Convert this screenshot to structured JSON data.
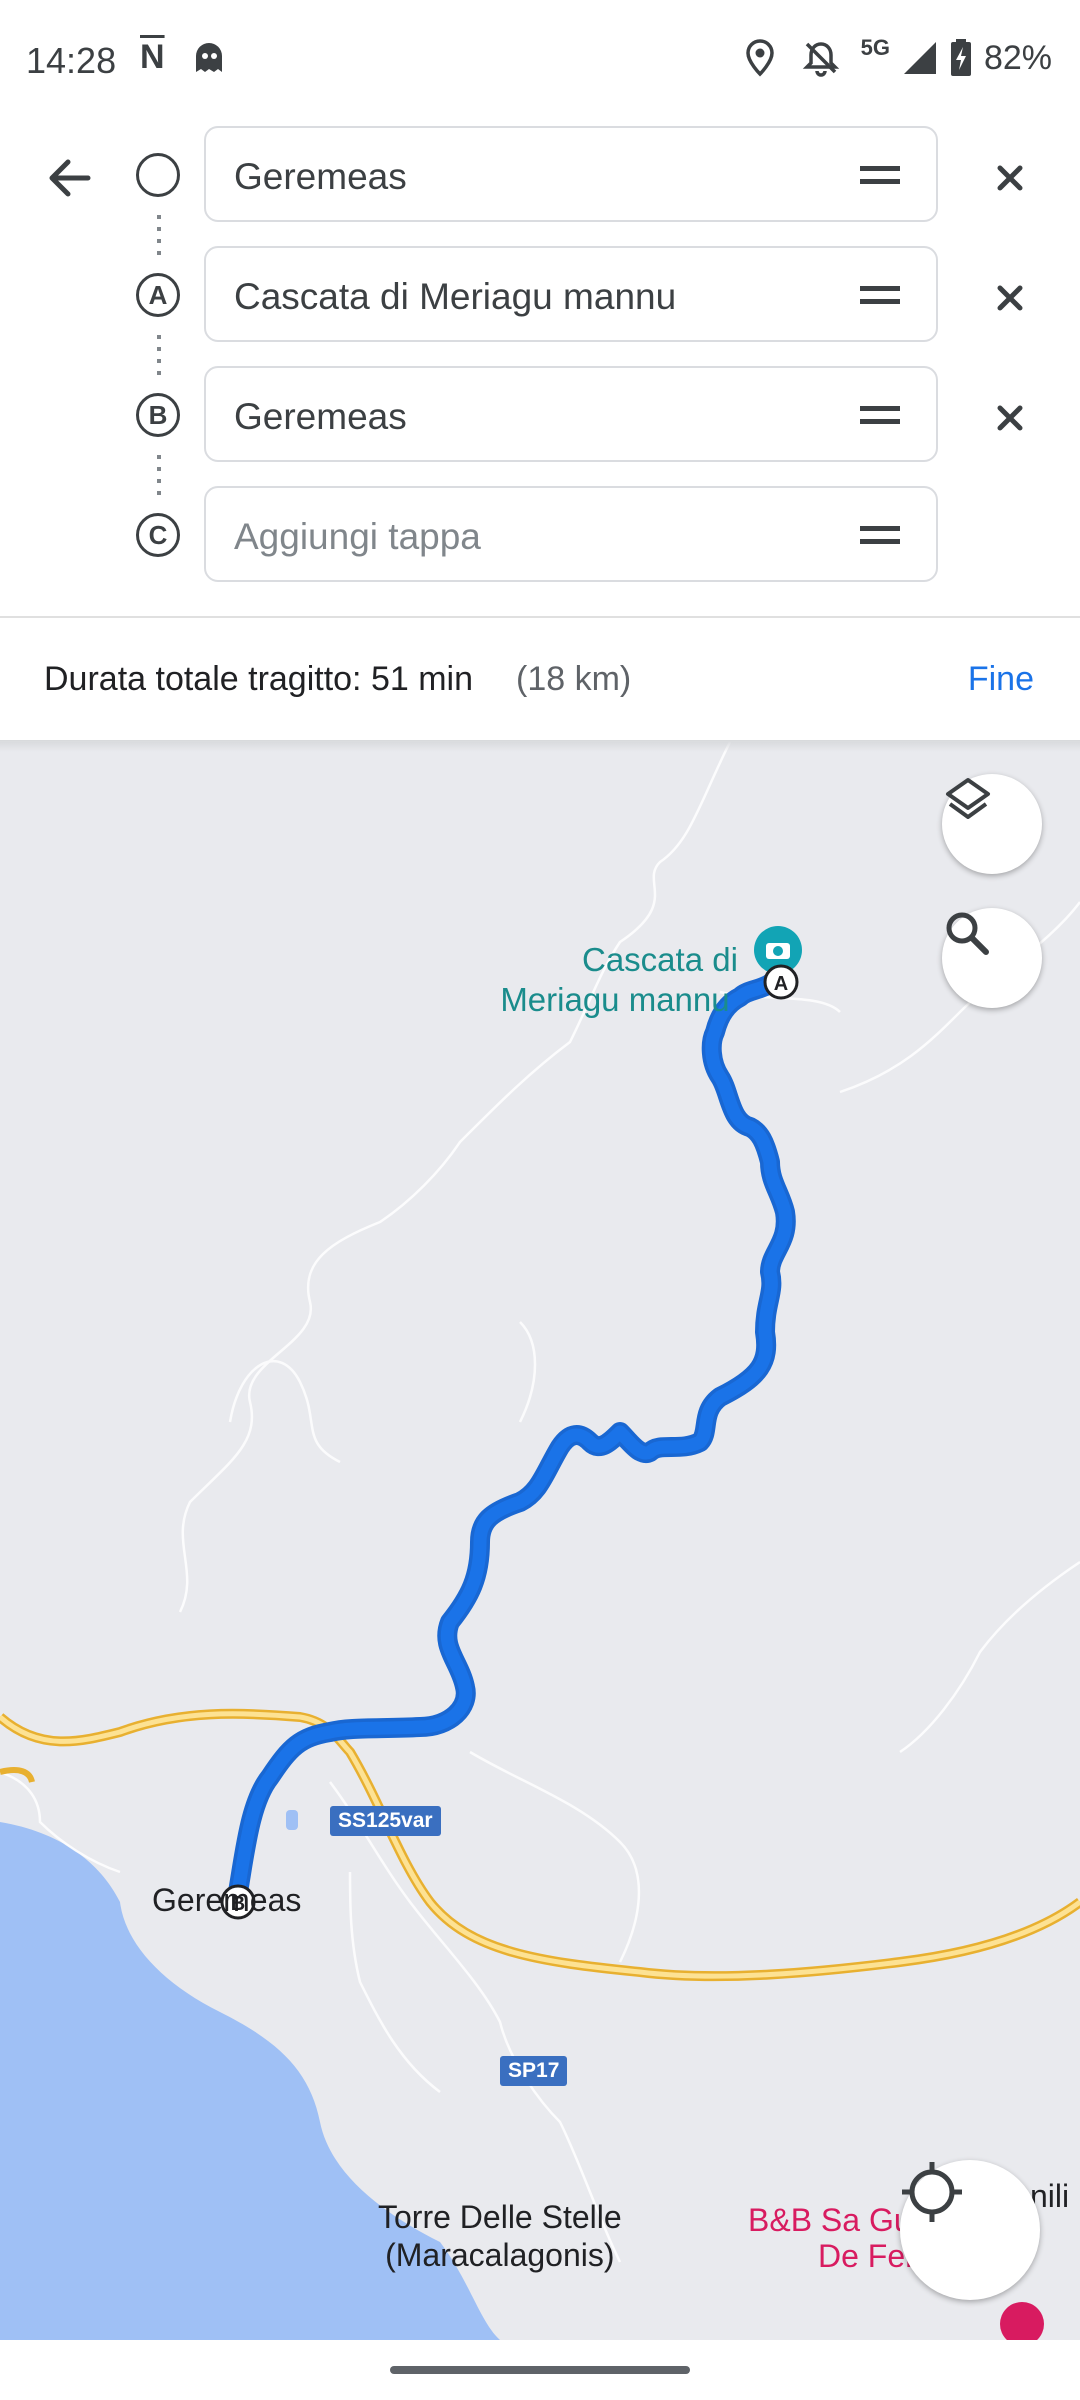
{
  "status_bar": {
    "time": "14:28",
    "network": "5G",
    "battery": "82%"
  },
  "route": {
    "stops": [
      {
        "marker": "",
        "value": "Geremeas",
        "placeholder": ""
      },
      {
        "marker": "A",
        "value": "Cascata di Meriagu mannu",
        "placeholder": ""
      },
      {
        "marker": "B",
        "value": "Geremeas",
        "placeholder": ""
      },
      {
        "marker": "C",
        "value": "",
        "placeholder": "Aggiungi tappa"
      }
    ]
  },
  "summary": {
    "duration": "Durata totale tragitto: 51 min",
    "distance": "(18 km)",
    "done_label": "Fine"
  },
  "map": {
    "poi_label_line1": "Cascata di",
    "poi_label_line2": "Meriagu mannu",
    "marker_a": "A",
    "marker_b": "B",
    "town": "Geremeas",
    "road_badge_1": "SS125var",
    "road_badge_2": "SP17",
    "place_1_line1": "Torre Delle Stelle",
    "place_1_line2": "(Maracalagonis)",
    "place_2_line1": "B&B Sa Guardia",
    "place_2_line2": "De Fenici",
    "place_3": "nili l",
    "route_color": "#1a73e8",
    "water_color": "#9fc0f5",
    "road_color": "#f6c343"
  }
}
